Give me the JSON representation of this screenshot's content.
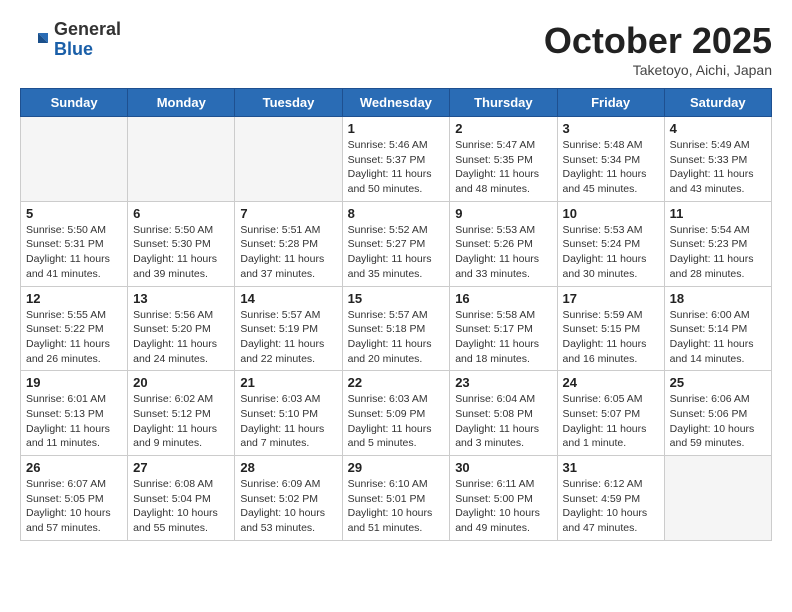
{
  "header": {
    "logo_general": "General",
    "logo_blue": "Blue",
    "month_title": "October 2025",
    "location": "Taketoyo, Aichi, Japan"
  },
  "weekdays": [
    "Sunday",
    "Monday",
    "Tuesday",
    "Wednesday",
    "Thursday",
    "Friday",
    "Saturday"
  ],
  "weeks": [
    [
      {
        "day": "",
        "info": ""
      },
      {
        "day": "",
        "info": ""
      },
      {
        "day": "",
        "info": ""
      },
      {
        "day": "1",
        "info": "Sunrise: 5:46 AM\nSunset: 5:37 PM\nDaylight: 11 hours and 50 minutes."
      },
      {
        "day": "2",
        "info": "Sunrise: 5:47 AM\nSunset: 5:35 PM\nDaylight: 11 hours and 48 minutes."
      },
      {
        "day": "3",
        "info": "Sunrise: 5:48 AM\nSunset: 5:34 PM\nDaylight: 11 hours and 45 minutes."
      },
      {
        "day": "4",
        "info": "Sunrise: 5:49 AM\nSunset: 5:33 PM\nDaylight: 11 hours and 43 minutes."
      }
    ],
    [
      {
        "day": "5",
        "info": "Sunrise: 5:50 AM\nSunset: 5:31 PM\nDaylight: 11 hours and 41 minutes."
      },
      {
        "day": "6",
        "info": "Sunrise: 5:50 AM\nSunset: 5:30 PM\nDaylight: 11 hours and 39 minutes."
      },
      {
        "day": "7",
        "info": "Sunrise: 5:51 AM\nSunset: 5:28 PM\nDaylight: 11 hours and 37 minutes."
      },
      {
        "day": "8",
        "info": "Sunrise: 5:52 AM\nSunset: 5:27 PM\nDaylight: 11 hours and 35 minutes."
      },
      {
        "day": "9",
        "info": "Sunrise: 5:53 AM\nSunset: 5:26 PM\nDaylight: 11 hours and 33 minutes."
      },
      {
        "day": "10",
        "info": "Sunrise: 5:53 AM\nSunset: 5:24 PM\nDaylight: 11 hours and 30 minutes."
      },
      {
        "day": "11",
        "info": "Sunrise: 5:54 AM\nSunset: 5:23 PM\nDaylight: 11 hours and 28 minutes."
      }
    ],
    [
      {
        "day": "12",
        "info": "Sunrise: 5:55 AM\nSunset: 5:22 PM\nDaylight: 11 hours and 26 minutes."
      },
      {
        "day": "13",
        "info": "Sunrise: 5:56 AM\nSunset: 5:20 PM\nDaylight: 11 hours and 24 minutes."
      },
      {
        "day": "14",
        "info": "Sunrise: 5:57 AM\nSunset: 5:19 PM\nDaylight: 11 hours and 22 minutes."
      },
      {
        "day": "15",
        "info": "Sunrise: 5:57 AM\nSunset: 5:18 PM\nDaylight: 11 hours and 20 minutes."
      },
      {
        "day": "16",
        "info": "Sunrise: 5:58 AM\nSunset: 5:17 PM\nDaylight: 11 hours and 18 minutes."
      },
      {
        "day": "17",
        "info": "Sunrise: 5:59 AM\nSunset: 5:15 PM\nDaylight: 11 hours and 16 minutes."
      },
      {
        "day": "18",
        "info": "Sunrise: 6:00 AM\nSunset: 5:14 PM\nDaylight: 11 hours and 14 minutes."
      }
    ],
    [
      {
        "day": "19",
        "info": "Sunrise: 6:01 AM\nSunset: 5:13 PM\nDaylight: 11 hours and 11 minutes."
      },
      {
        "day": "20",
        "info": "Sunrise: 6:02 AM\nSunset: 5:12 PM\nDaylight: 11 hours and 9 minutes."
      },
      {
        "day": "21",
        "info": "Sunrise: 6:03 AM\nSunset: 5:10 PM\nDaylight: 11 hours and 7 minutes."
      },
      {
        "day": "22",
        "info": "Sunrise: 6:03 AM\nSunset: 5:09 PM\nDaylight: 11 hours and 5 minutes."
      },
      {
        "day": "23",
        "info": "Sunrise: 6:04 AM\nSunset: 5:08 PM\nDaylight: 11 hours and 3 minutes."
      },
      {
        "day": "24",
        "info": "Sunrise: 6:05 AM\nSunset: 5:07 PM\nDaylight: 11 hours and 1 minute."
      },
      {
        "day": "25",
        "info": "Sunrise: 6:06 AM\nSunset: 5:06 PM\nDaylight: 10 hours and 59 minutes."
      }
    ],
    [
      {
        "day": "26",
        "info": "Sunrise: 6:07 AM\nSunset: 5:05 PM\nDaylight: 10 hours and 57 minutes."
      },
      {
        "day": "27",
        "info": "Sunrise: 6:08 AM\nSunset: 5:04 PM\nDaylight: 10 hours and 55 minutes."
      },
      {
        "day": "28",
        "info": "Sunrise: 6:09 AM\nSunset: 5:02 PM\nDaylight: 10 hours and 53 minutes."
      },
      {
        "day": "29",
        "info": "Sunrise: 6:10 AM\nSunset: 5:01 PM\nDaylight: 10 hours and 51 minutes."
      },
      {
        "day": "30",
        "info": "Sunrise: 6:11 AM\nSunset: 5:00 PM\nDaylight: 10 hours and 49 minutes."
      },
      {
        "day": "31",
        "info": "Sunrise: 6:12 AM\nSunset: 4:59 PM\nDaylight: 10 hours and 47 minutes."
      },
      {
        "day": "",
        "info": ""
      }
    ]
  ]
}
